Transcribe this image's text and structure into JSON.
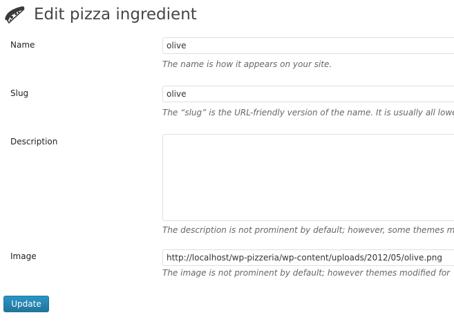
{
  "header": {
    "icon": "pizza-slice-icon",
    "title": "Edit pizza ingredient"
  },
  "form": {
    "name": {
      "label": "Name",
      "value": "olive",
      "description": "The name is how it appears on your site."
    },
    "slug": {
      "label": "Slug",
      "value": "olive",
      "description": "The “slug” is the URL-friendly version of the name. It is usually all lowe"
    },
    "description": {
      "label": "Description",
      "value": "",
      "description": "The description is not prominent by default; however, some themes m"
    },
    "image": {
      "label": "Image",
      "value": "http://localhost/wp-pizzeria/wp-content/uploads/2012/05/olive.png",
      "description": "The image is not prominent by default; however themes modified for"
    }
  },
  "actions": {
    "update_label": "Update"
  },
  "colors": {
    "button": "#21759b",
    "description_text": "#666666",
    "input_border": "#dfdfdf"
  }
}
